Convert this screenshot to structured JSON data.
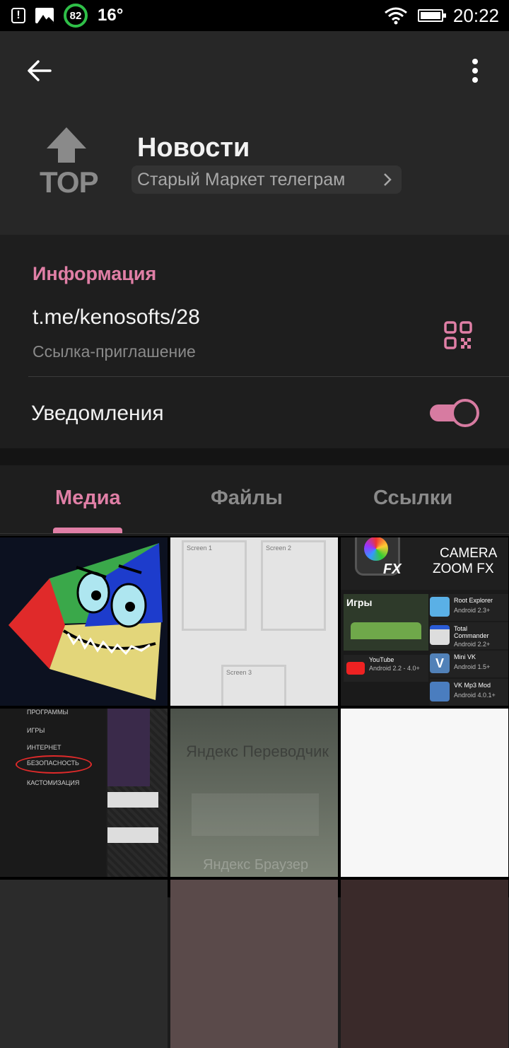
{
  "status_bar": {
    "battery_ring": "82",
    "temperature": "16°",
    "time": "20:22"
  },
  "header": {
    "title": "Новости",
    "subtitle": "Старый Маркет телеграм",
    "avatar_text": "TOP"
  },
  "info": {
    "section_title": "Информация",
    "link": "t.me/kenosofts/28",
    "link_caption": "Ссылка-приглашение",
    "notifications_label": "Уведомления",
    "notifications_on": true
  },
  "tabs": [
    {
      "label": "Медиа",
      "active": true
    },
    {
      "label": "Файлы",
      "active": false
    },
    {
      "label": "Ссылки",
      "active": false
    }
  ],
  "media": {
    "screen1": "Screen 1",
    "screen2": "Screen 2",
    "screen3": "Screen 3",
    "camera_title": "CAMERA",
    "camera_sub": "ZOOM FX",
    "fx": "FX",
    "games": "Игры",
    "apps": [
      {
        "name": "Root Explorer",
        "ver": "Android 2.3+"
      },
      {
        "name": "Total Commander",
        "ver": "Android 2.2+"
      },
      {
        "name": "Mini VK",
        "ver": "Android 1.5+"
      },
      {
        "name": "VK Mp3 Mod",
        "ver": "Android 4.0.1+"
      }
    ],
    "youtube": {
      "name": "YouTube",
      "ver": "Android 2.2 - 4.0+"
    },
    "menu_items": [
      "ПРОГРАММЫ",
      "ИГРЫ",
      "ИНТЕРНЕТ",
      "БЕЗОПАСНОСТЬ",
      "КАСТОМИЗАЦИЯ"
    ],
    "yandex_translate": "Яндекс Переводчик",
    "yandex_browser": "Яндекс Браузер"
  },
  "colors": {
    "accent": "#e07fa6",
    "header_bg": "#272727",
    "body_bg": "#1e1e1e"
  }
}
